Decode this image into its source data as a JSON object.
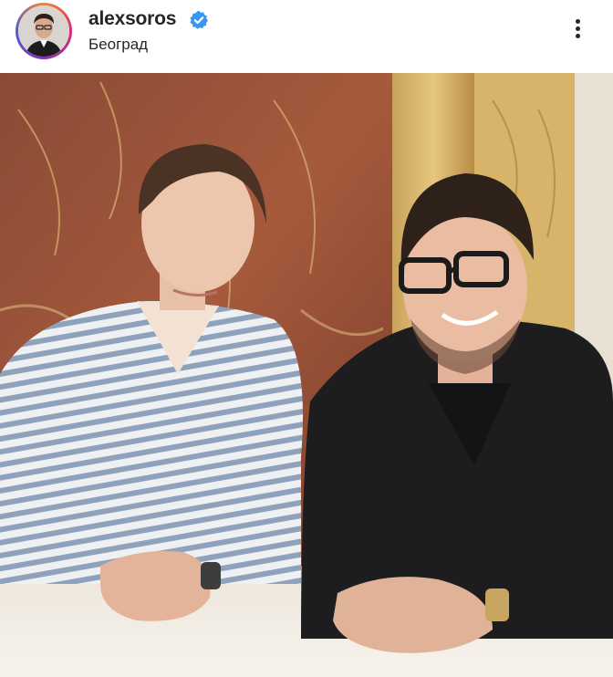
{
  "post": {
    "username": "alexsoros",
    "location": "Београд",
    "verified": true,
    "icons": {
      "verified": "verified-badge-icon",
      "more": "more-options-icon"
    },
    "colors": {
      "verified_blue": "#3897f0",
      "text": "#262626"
    }
  }
}
